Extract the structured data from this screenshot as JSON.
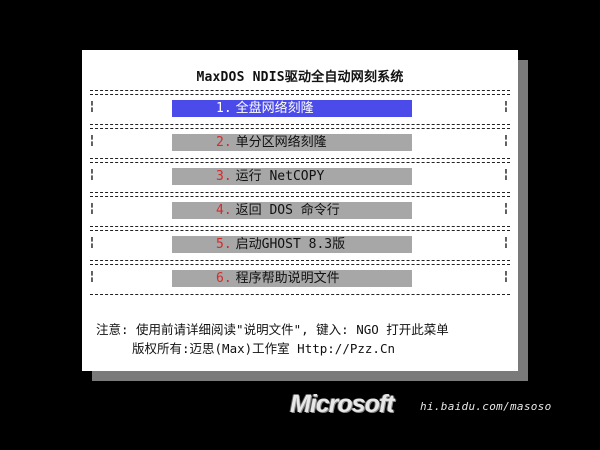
{
  "window": {
    "title": "MaxDOS NDIS驱动全自动网刻系统"
  },
  "menu": {
    "selected_index": 0,
    "items": [
      {
        "num": "1.",
        "label": "全盘网络刻隆"
      },
      {
        "num": "2.",
        "label": "单分区网络刻隆"
      },
      {
        "num": "3.",
        "label": "运行 NetCOPY"
      },
      {
        "num": "4.",
        "label": "返回 DOS 命令行"
      },
      {
        "num": "5.",
        "label": "启动GHOST 8.3版"
      },
      {
        "num": "6.",
        "label": "程序帮助说明文件"
      }
    ]
  },
  "footer": {
    "note_line1": "注意: 使用前请详细阅读\"说明文件\", 键入: NGO 打开此菜单",
    "note_line2": "版权所有:迈思(Max)工作室 Http://Pzz.Cn"
  },
  "watermark": {
    "brand": "Microsoft",
    "url": "hi.baidu.com/masoso"
  },
  "colors": {
    "background": "#000000",
    "dialog": "#ffffff",
    "item_bg": "#a7a7a7",
    "selected_bg": "#4b4be9",
    "number": "#d42a2a"
  }
}
